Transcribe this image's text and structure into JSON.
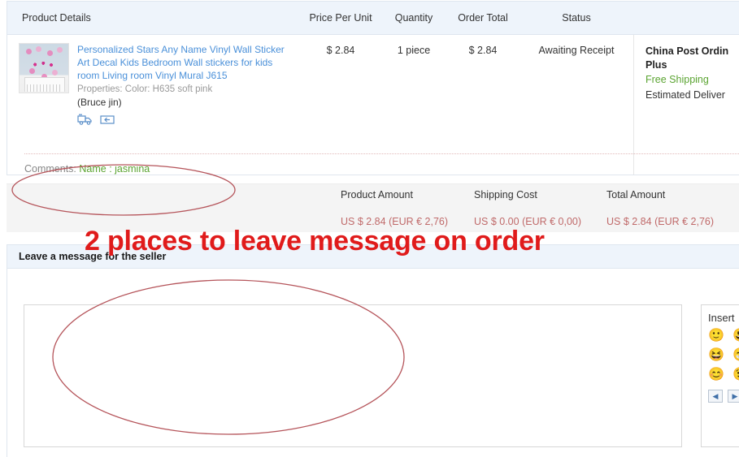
{
  "order_table": {
    "headers": {
      "product": "Product Details",
      "price": "Price Per Unit",
      "quantity": "Quantity",
      "order_total": "Order Total",
      "status": "Status"
    },
    "row": {
      "product_title": "Personalized Stars Any Name Vinyl Wall Sticker Art Decal Kids Bedroom Wall stickers for kids room Living room Vinyl Mural J615",
      "properties": "Properties: Color: H635 soft pink",
      "seller": "(Bruce jin)",
      "price_per_unit": "$ 2.84",
      "quantity": "1 piece",
      "order_total": "$ 2.84",
      "status": "Awaiting Receipt",
      "shipping_method": "China Post Ordin Plus",
      "shipping_free": "Free Shipping",
      "shipping_eta": "Estimated Deliver"
    },
    "comments": {
      "label": "Comments:",
      "value": "Name : jasmina"
    },
    "amounts": [
      {
        "label": "Product Amount",
        "value": "US $ 2.84 (EUR € 2,76)"
      },
      {
        "label": "Shipping Cost",
        "value": "US $ 0.00 (EUR € 0,00)"
      },
      {
        "label": "Total Amount",
        "value": "US $ 2.84 (EUR € 2,76)"
      }
    ]
  },
  "message_section": {
    "title": "Leave a message for the seller",
    "textarea_value": "",
    "textarea_placeholder": "",
    "emoji_panel": {
      "title": "Insert",
      "emojis": [
        "🙂",
        "😃",
        "😆",
        "😁",
        "😊",
        "😉"
      ],
      "prev_label": "◀",
      "next_label": "▶"
    }
  },
  "annotation": {
    "text": "2 places to leave message on order",
    "color": "#e01b1b",
    "ellipse_color": "#c0392b"
  },
  "colors": {
    "header_bg": "#eef4fb",
    "link": "#4a90d9",
    "green": "#5ba432",
    "amount": "#c06a6a",
    "band_bg": "#f4f4f4"
  }
}
